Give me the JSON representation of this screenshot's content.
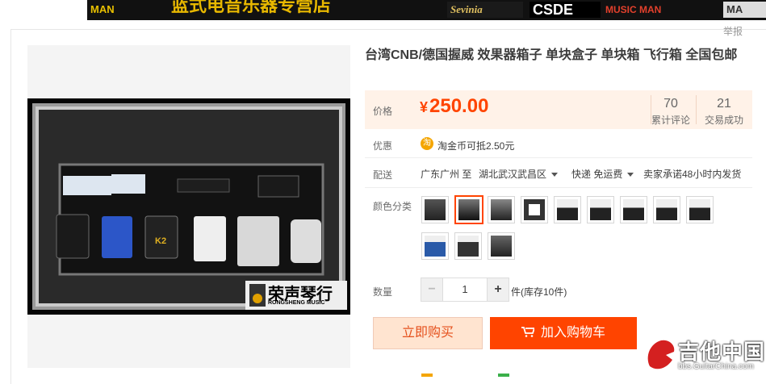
{
  "banner": {
    "left_text": "MAN",
    "center_text": "蓝式电音乐器专营店",
    "brand1": "Sevinia",
    "brand2": "CSDE",
    "brand3": "MUSIC MAN",
    "brand4": "MA"
  },
  "report_label": "举报",
  "product": {
    "title": "台湾CNB/德国握威 效果器箱子 单块盒子 单块箱 飞行箱 全国包邮"
  },
  "price": {
    "label": "价格",
    "currency": "¥",
    "value": "250.00"
  },
  "stats": {
    "reviews_count": "70",
    "reviews_label": "累计评论",
    "sold_count": "21",
    "sold_label": "交易成功"
  },
  "promo": {
    "label": "优惠",
    "icon_char": "淘",
    "text": "淘金币可抵2.50元"
  },
  "shipping": {
    "label": "配送",
    "from": "广东广州 至",
    "to": "湖北武汉武昌区",
    "method": "快递 免运费",
    "promise": "卖家承诺48小时内发货"
  },
  "color": {
    "label": "颜色分类",
    "selected_index": 1,
    "options_count": 12
  },
  "quantity": {
    "label": "数量",
    "minus": "−",
    "value": "1",
    "plus": "+",
    "stock": "件(库存10件)"
  },
  "buttons": {
    "buy_now": "立即购买",
    "add_to_cart": "加入购物车"
  },
  "watermark": {
    "text": "吉他中国",
    "url": "bbs.GuitarChina.com"
  },
  "photo_logo": {
    "cn": "荣声琴行",
    "en": "RONGSHENG MUSIC"
  },
  "colors": {
    "accent": "#ff4400",
    "price_bg": "#fff2e8",
    "buy_bg": "#ffe4d0"
  }
}
